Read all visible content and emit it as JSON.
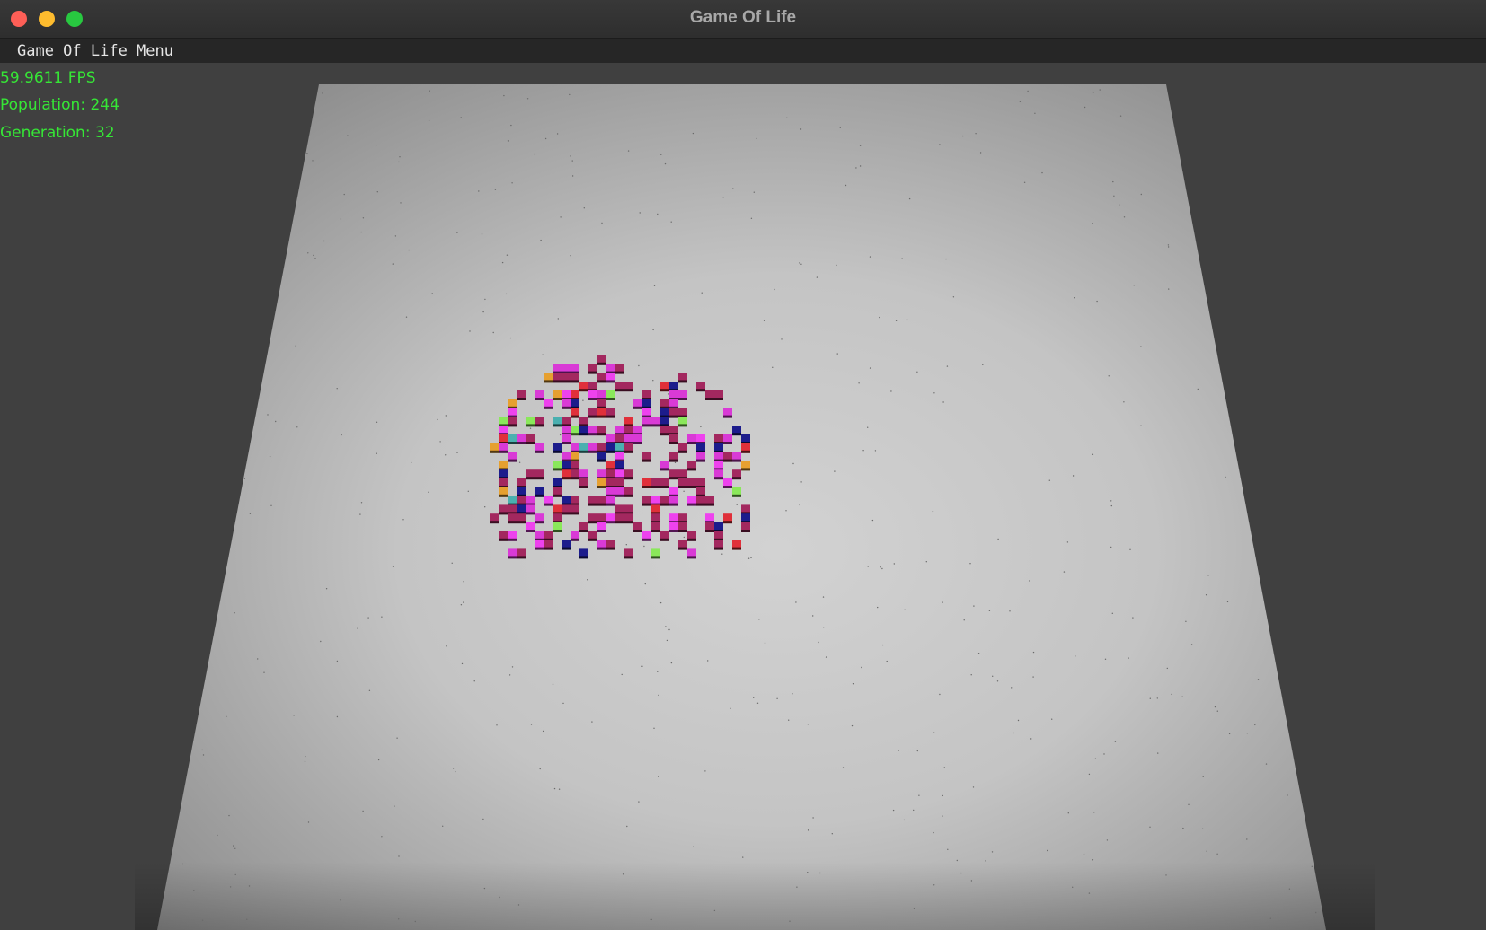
{
  "window": {
    "title": "Game Of Life"
  },
  "menu": {
    "items": [
      {
        "label": "Game Of Life Menu"
      }
    ]
  },
  "hud": {
    "fps": "59.9611 FPS",
    "population": "Population: 244",
    "generation": "Generation: 32"
  },
  "colors": {
    "hud_text": "#36e636",
    "board": "#c8c8c8",
    "background": "#404040",
    "cell_palette": [
      "#a3285f",
      "#d93ad6",
      "#ee42ee",
      "#1c1c8c",
      "#e0303a",
      "#e6a030",
      "#8ae85a",
      "#4ab0b0",
      "#e08080"
    ]
  }
}
